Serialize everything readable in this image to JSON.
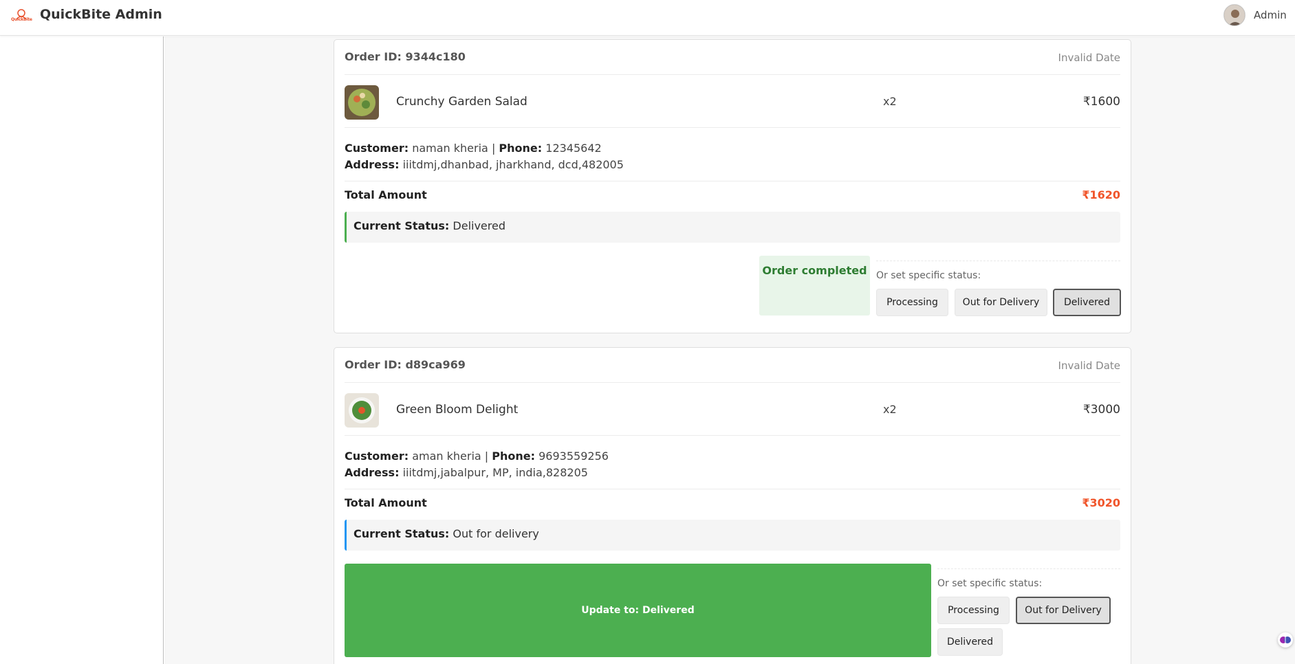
{
  "header": {
    "logo_text": "QuickBite",
    "title": "QuickBite Admin",
    "user_label": "Admin"
  },
  "orders": [
    {
      "order_id": "Order ID: 9344c180",
      "date": "Invalid Date",
      "item": {
        "name": "Crunchy Garden Salad",
        "qty": "x2",
        "price": "₹1600"
      },
      "customer_label": "Customer:",
      "customer": "naman kheria",
      "phone_label": "Phone:",
      "phone": "12345642",
      "address_label": "Address:",
      "address": "iiitdmj,dhanbad, jharkhand, dcd,482005",
      "total_label": "Total Amount",
      "total": "₹1620",
      "status_label": "Current Status:",
      "status": "Delivered",
      "completed_text": "Order completed",
      "set_label": "Or set specific status:",
      "buttons": [
        "Processing",
        "Out for Delivery",
        "Delivered"
      ],
      "active_status": "Delivered"
    },
    {
      "order_id": "Order ID: d89ca969",
      "date": "Invalid Date",
      "item": {
        "name": "Green Bloom Delight",
        "qty": "x2",
        "price": "₹3000"
      },
      "customer_label": "Customer:",
      "customer": "aman kheria",
      "phone_label": "Phone:",
      "phone": "9693559256",
      "address_label": "Address:",
      "address": "iiitdmj,jabalpur, MP, india,828205",
      "total_label": "Total Amount",
      "total": "₹3020",
      "status_label": "Current Status:",
      "status": "Out for delivery",
      "update_button": "Update to: Delivered",
      "set_label": "Or set specific status:",
      "buttons": [
        "Processing",
        "Out for Delivery",
        "Delivered"
      ],
      "active_status": "Out for Delivery"
    }
  ],
  "colors": {
    "accent": "#f0552b",
    "success": "#4caf50",
    "success_text": "#2e7d32",
    "info": "#2196f3"
  }
}
